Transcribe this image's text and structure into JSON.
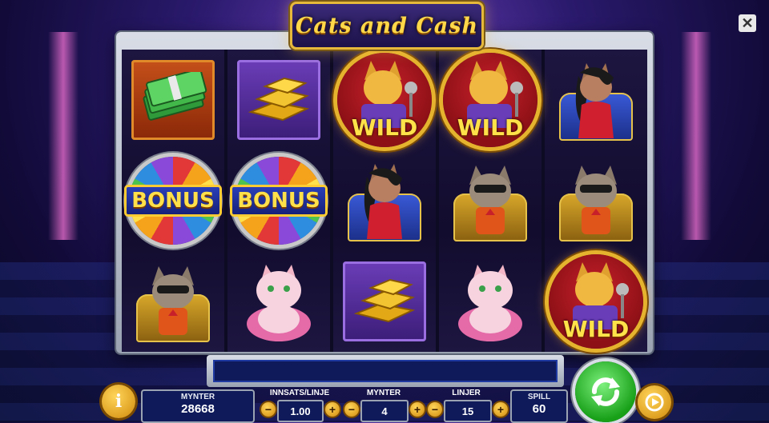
{
  "game": {
    "title": "Cats and Cash"
  },
  "reels": [
    [
      "cash-stack",
      "bonus-wheel",
      "gray-cat"
    ],
    [
      "gold-bars",
      "bonus-wheel",
      "pink-cat"
    ],
    [
      "wild-cat",
      "lady-cat",
      "gold-bars"
    ],
    [
      "wild-cat",
      "gray-cat",
      "pink-cat"
    ],
    [
      "lady-cat",
      "gray-cat",
      "wild-cat"
    ]
  ],
  "symbol_text": {
    "wild": "WILD",
    "bonus": "BONUS"
  },
  "controls": {
    "coins_panel": {
      "label": "MYNTER",
      "value": "28668"
    },
    "bet_per_line": {
      "label": "INNSATS/LINJE",
      "value": "1.00"
    },
    "coins": {
      "label": "MYNTER",
      "value": "4"
    },
    "lines": {
      "label": "LINJER",
      "value": "15"
    },
    "play": {
      "label": "SPILL",
      "value": "60"
    },
    "minus": "−",
    "plus": "+",
    "info": "i"
  },
  "colors": {
    "accent_gold": "#ffd84a",
    "panel_bg": "#0e1a5a",
    "spin_green": "#18a018",
    "wild_red": "#c8202a"
  },
  "icons": {
    "close": "close-icon",
    "info": "info-icon",
    "spin": "spin-icon",
    "autoplay": "autoplay-icon"
  }
}
